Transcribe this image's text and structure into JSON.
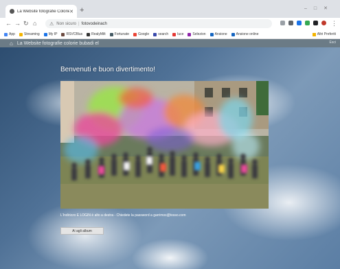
{
  "browser": {
    "tab_title": "La Website fotografie Colorie...",
    "url_security": "Non sicuro",
    "url": "fotovodeinach",
    "bookmarks": [
      "App",
      "Streaming",
      "My IP",
      "RSVCBlus",
      "RealyMilt",
      "Fortunate",
      "Google",
      "search",
      "luce",
      "Selezion",
      "Ansione",
      "Ansione online"
    ],
    "bookmarks_right": "Altri Preferiti",
    "colors": {
      "tabbar": "#dee1e6",
      "omnibox": "#f1f3f4"
    }
  },
  "site": {
    "title": "La Website fotografie colorie bubadi el",
    "logout": "Esci",
    "welcome": "Benvenuti e buon divertimento!",
    "notice": "L'Indirizzo E LOGIN è alto a destra - Chiedete la password a garrimos@tosso.com",
    "button_label": "Ai agli album",
    "accent": "#6b7b86"
  }
}
